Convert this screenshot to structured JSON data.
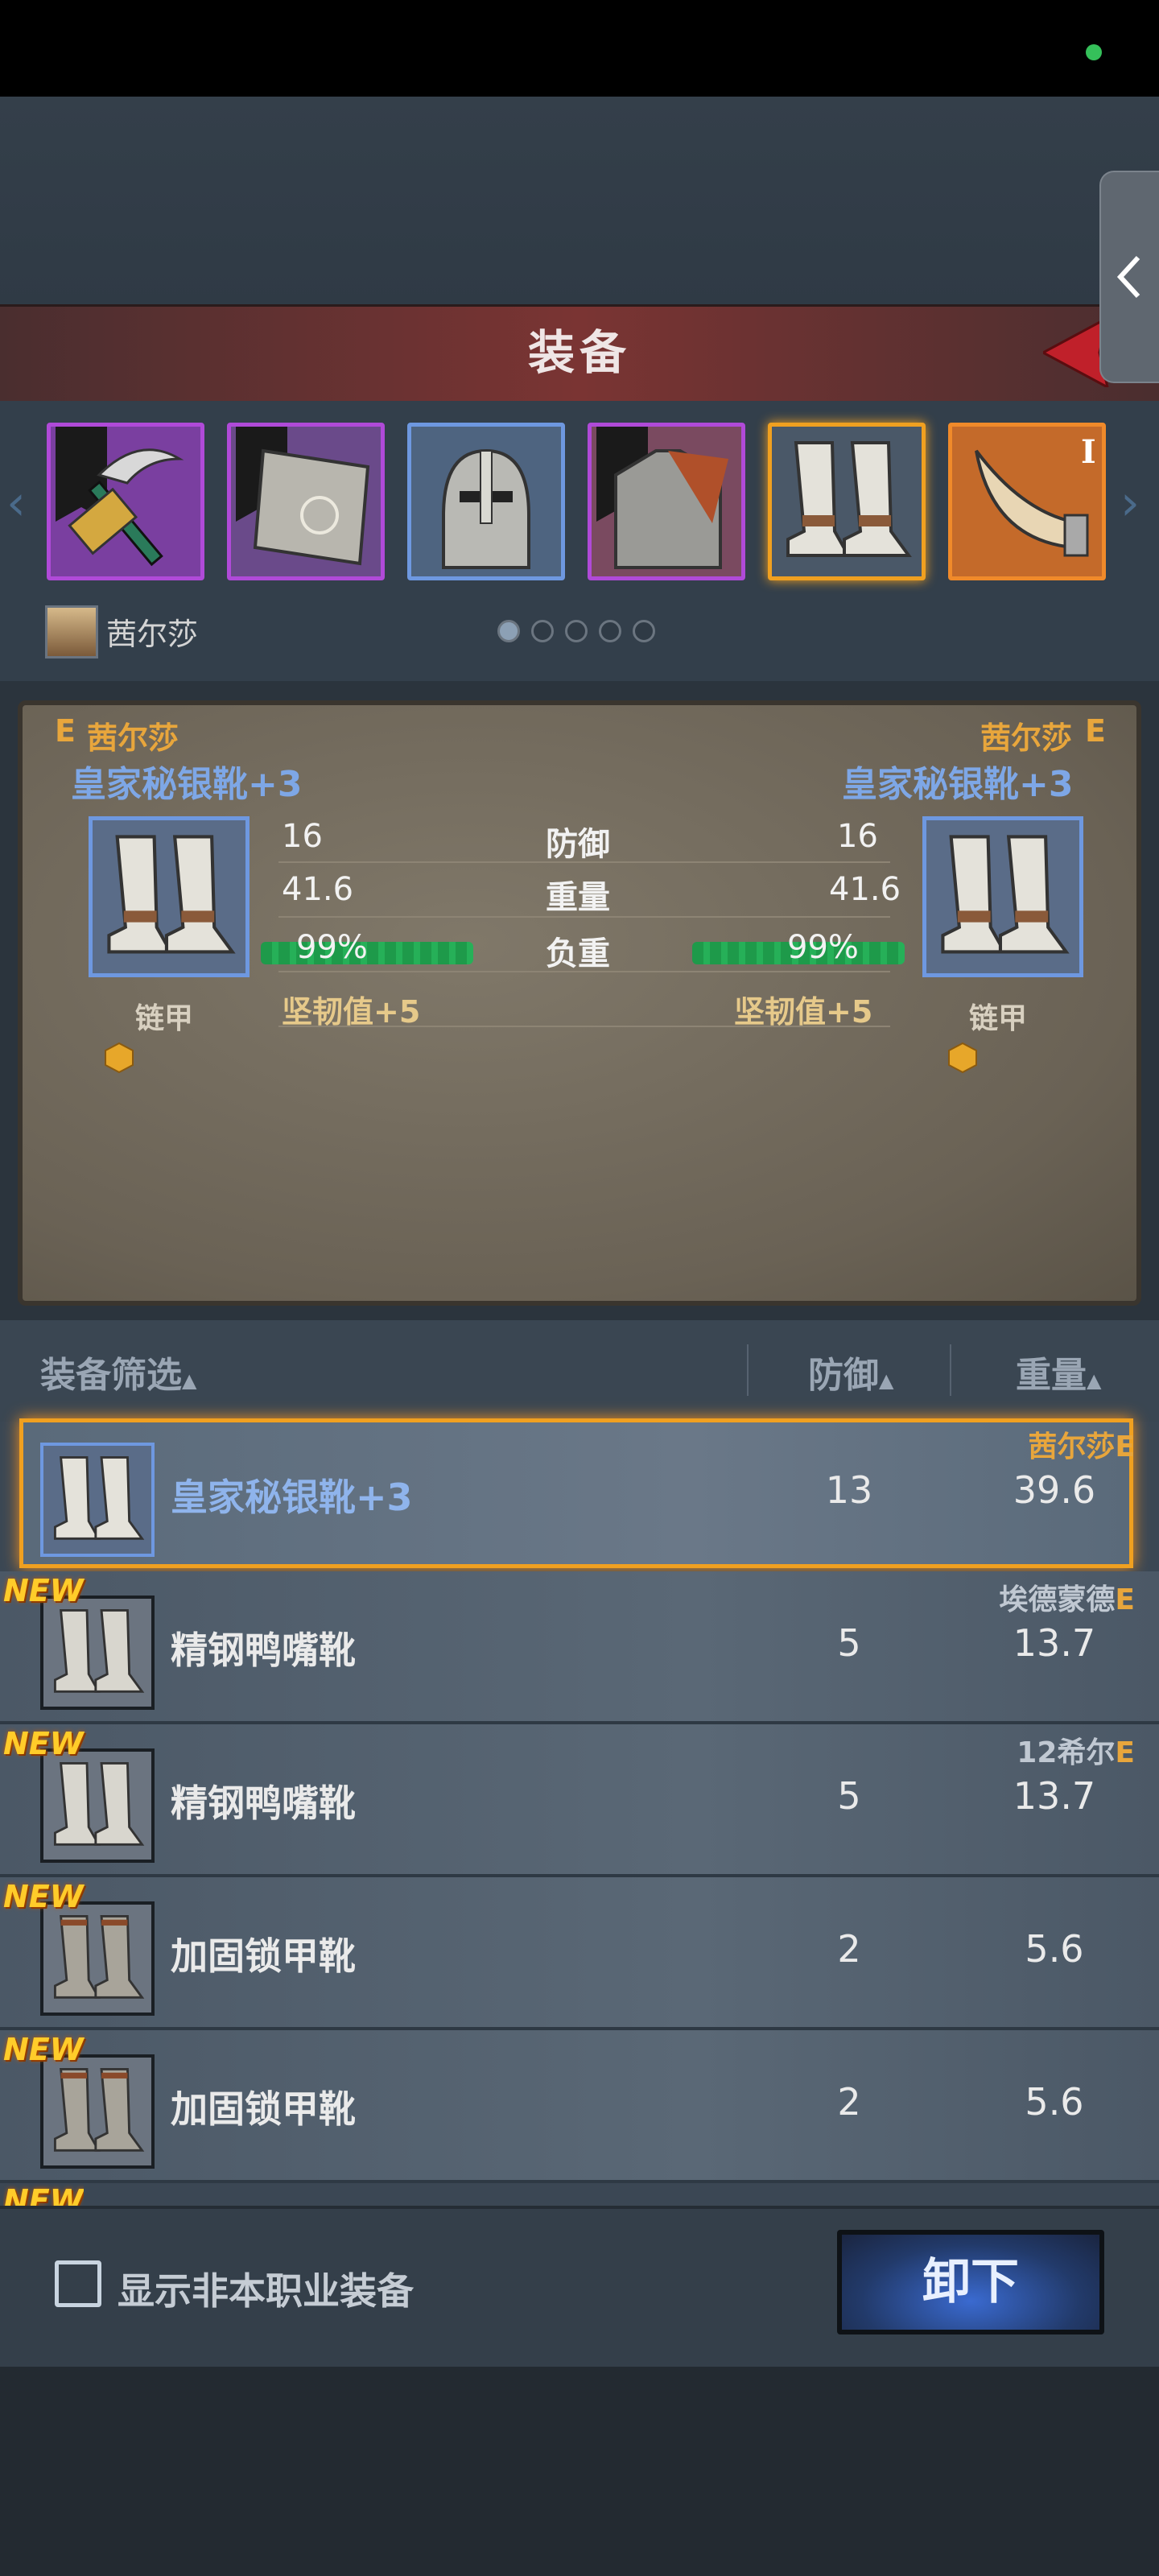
{
  "header": {
    "title": "装备"
  },
  "slots": [
    {
      "name": "pickaxe",
      "rarity": "purple",
      "border": "#b04ad8",
      "has_banner": true
    },
    {
      "name": "shield",
      "rarity": "purple",
      "border": "#b04ad8",
      "has_banner": true
    },
    {
      "name": "helmet",
      "rarity": "blue",
      "border": "#6e98e0",
      "has_banner": false
    },
    {
      "name": "chest-armor",
      "rarity": "purple",
      "border": "#b04ad8",
      "has_banner": true
    },
    {
      "name": "boots",
      "rarity": "selected",
      "border": "#f0a020",
      "has_banner": false
    },
    {
      "name": "horn",
      "rarity": "orange",
      "border": "#f08a2a",
      "has_banner": false,
      "tier": "I"
    }
  ],
  "character": {
    "name": "茜尔莎",
    "page_count": 5,
    "active_page": 1
  },
  "compare": {
    "left": {
      "owner_prefix": "E",
      "owner": "茜尔莎",
      "item_name": "皇家秘银靴+3",
      "armor_type": "链甲",
      "defense": "16",
      "weight": "41.6",
      "load": "99%",
      "toughness": "坚韧值+5"
    },
    "right": {
      "owner_prefix": "E",
      "owner": "茜尔莎",
      "item_name": "皇家秘银靴+3",
      "armor_type": "链甲",
      "defense": "16",
      "weight": "41.6",
      "load": "99%",
      "toughness": "坚韧值+5"
    },
    "labels": {
      "defense": "防御",
      "weight": "重量",
      "load": "负重"
    }
  },
  "list_header": {
    "filter": "装备筛选",
    "defense": "防御",
    "weight": "重量"
  },
  "items": [
    {
      "name": "皇家秘银靴+3",
      "defense": "13",
      "weight": "39.6",
      "owner": "茜尔莎",
      "owner_suffix": "E",
      "is_new": false,
      "selected": true,
      "kind": "silver-boots"
    },
    {
      "name": "精钢鸭嘴靴",
      "defense": "5",
      "weight": "13.7",
      "owner": "埃德蒙德",
      "owner_suffix": "E",
      "is_new": true,
      "selected": false,
      "kind": "steel-boots"
    },
    {
      "name": "精钢鸭嘴靴",
      "defense": "5",
      "weight": "13.7",
      "owner": "12希尔",
      "owner_suffix": "E",
      "is_new": true,
      "selected": false,
      "kind": "steel-boots"
    },
    {
      "name": "加固锁甲靴",
      "defense": "2",
      "weight": "5.6",
      "owner": "",
      "owner_suffix": "",
      "is_new": true,
      "selected": false,
      "kind": "chain-boots"
    },
    {
      "name": "加固锁甲靴",
      "defense": "2",
      "weight": "5.6",
      "owner": "",
      "owner_suffix": "",
      "is_new": true,
      "selected": false,
      "kind": "chain-boots"
    }
  ],
  "new_badge": "NEW",
  "footer": {
    "checkbox_label": "显示非本职业装备",
    "checkbox_checked": false,
    "unequip_label": "卸下"
  }
}
